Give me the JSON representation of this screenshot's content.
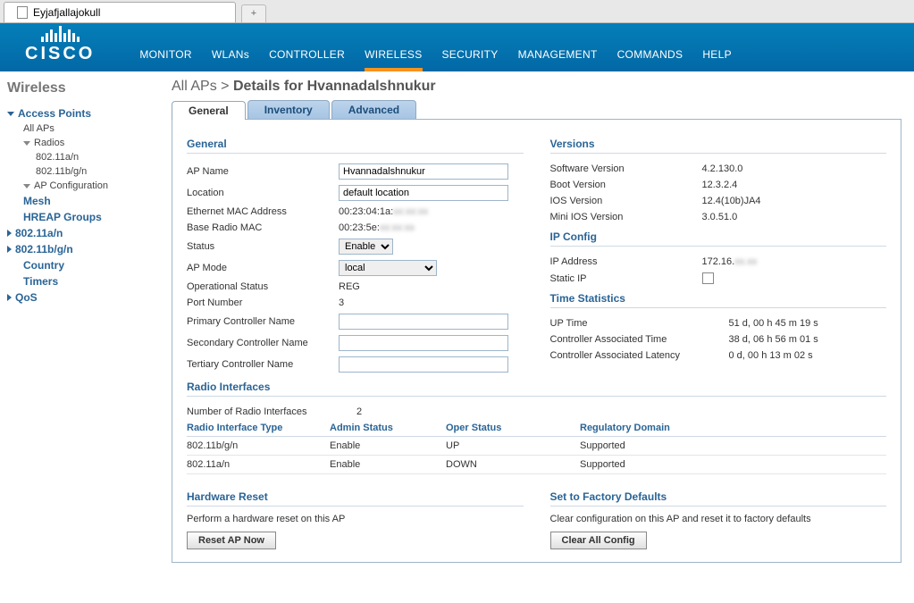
{
  "browser": {
    "tab_title": "Eyjafjallajokull"
  },
  "brand": "CISCO",
  "nav": {
    "monitor": "MONITOR",
    "wlans": "WLANs",
    "controller": "CONTROLLER",
    "wireless": "WIRELESS",
    "security": "SECURITY",
    "management": "MANAGEMENT",
    "commands": "COMMANDS",
    "help": "HELP"
  },
  "sidebar": {
    "title": "Wireless",
    "access_points": "Access Points",
    "all_aps": "All APs",
    "radios": "Radios",
    "radio_a": "802.11a/n",
    "radio_b": "802.11b/g/n",
    "ap_config": "AP Configuration",
    "mesh": "Mesh",
    "hreap": "HREAP Groups",
    "s_80211a": "802.11a/n",
    "s_80211b": "802.11b/g/n",
    "country": "Country",
    "timers": "Timers",
    "qos": "QoS"
  },
  "breadcrumb": {
    "root": "All APs",
    "sep": ">",
    "page": "Details for Hvannadalshnukur"
  },
  "tabs": {
    "general": "General",
    "inventory": "Inventory",
    "advanced": "Advanced"
  },
  "sections": {
    "general": "General",
    "versions": "Versions",
    "ipconfig": "IP Config",
    "timestats": "Time Statistics",
    "radio_if": "Radio Interfaces",
    "hw_reset": "Hardware Reset",
    "factory": "Set to Factory Defaults"
  },
  "general": {
    "ap_name_label": "AP Name",
    "ap_name_value": "Hvannadalshnukur",
    "location_label": "Location",
    "location_value": "default location",
    "eth_mac_label": "Ethernet MAC Address",
    "eth_mac_value": "00:23:04:1a:",
    "base_mac_label": "Base Radio MAC",
    "base_mac_value": "00:23:5e:",
    "status_label": "Status",
    "status_value": "Enable",
    "ap_mode_label": "AP Mode",
    "ap_mode_value": "local",
    "oper_label": "Operational Status",
    "oper_value": "REG",
    "port_label": "Port Number",
    "port_value": "3",
    "pri_ctrl_label": "Primary Controller Name",
    "pri_ctrl_value": "",
    "sec_ctrl_label": "Secondary Controller Name",
    "sec_ctrl_value": "",
    "ter_ctrl_label": "Tertiary Controller Name",
    "ter_ctrl_value": ""
  },
  "versions": {
    "sw_label": "Software Version",
    "sw_value": "4.2.130.0",
    "boot_label": "Boot Version",
    "boot_value": "12.3.2.4",
    "ios_label": "IOS Version",
    "ios_value": "12.4(10b)JA4",
    "mini_label": "Mini IOS Version",
    "mini_value": "3.0.51.0"
  },
  "ipconfig": {
    "ip_label": "IP Address",
    "ip_value": "172.16.",
    "static_label": "Static IP"
  },
  "timestats": {
    "up_label": "UP Time",
    "up_value": "51 d, 00 h 45 m 19 s",
    "assoc_label": "Controller Associated Time",
    "assoc_value": "38 d, 06 h 56 m 01 s",
    "lat_label": "Controller Associated Latency",
    "lat_value": "0 d, 00 h 13 m 02 s"
  },
  "radio": {
    "count_label": "Number of Radio Interfaces",
    "count_value": "2",
    "h_type": "Radio Interface Type",
    "h_admin": "Admin Status",
    "h_oper": "Oper Status",
    "h_reg": "Regulatory Domain",
    "rows": [
      {
        "type": "802.11b/g/n",
        "admin": "Enable",
        "oper": "UP",
        "reg": "Supported"
      },
      {
        "type": "802.11a/n",
        "admin": "Enable",
        "oper": "DOWN",
        "reg": "Supported"
      }
    ]
  },
  "hw_reset": {
    "text": "Perform a hardware reset on this AP",
    "button": "Reset AP Now"
  },
  "factory": {
    "text": "Clear configuration on this AP and reset it to factory defaults",
    "button": "Clear All Config"
  }
}
